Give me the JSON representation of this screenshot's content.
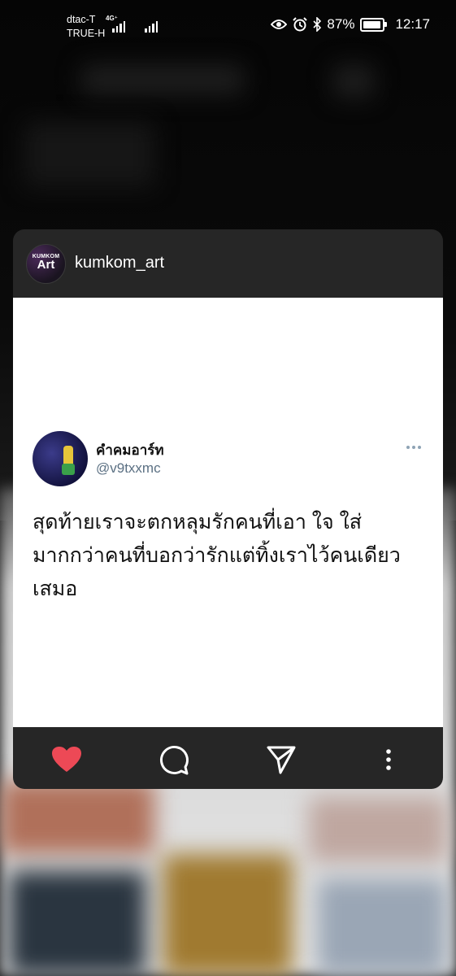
{
  "status_bar": {
    "carrier_1": "dtac-T",
    "carrier_2": "TRUE-H",
    "network": "4G⁺",
    "battery": "87%",
    "battery_level": 0.87,
    "time": "12:17",
    "icons": [
      "eye-icon",
      "alarm-icon",
      "bluetooth-icon",
      "battery-icon"
    ]
  },
  "card": {
    "avatar_text_small": "KUMKOM",
    "avatar_text_big": "Art",
    "username": "kumkom_art",
    "post": {
      "display_name": "คำคมอาร์ท",
      "handle": "@v9txxmc",
      "text": "สุดท้ายเราจะตกหลุมรักคนที่เอา ใจ ใส่\nมากกว่าคนที่บอกว่ารักแต่ทิ้งเราไว้คนเดียว\nเสมอ"
    },
    "actions": [
      "heart-icon",
      "comment-icon",
      "share-icon",
      "more-vertical-icon"
    ],
    "colors": {
      "card_bg": "#262626",
      "like": "#ed4956",
      "handle": "#5b7083"
    }
  }
}
